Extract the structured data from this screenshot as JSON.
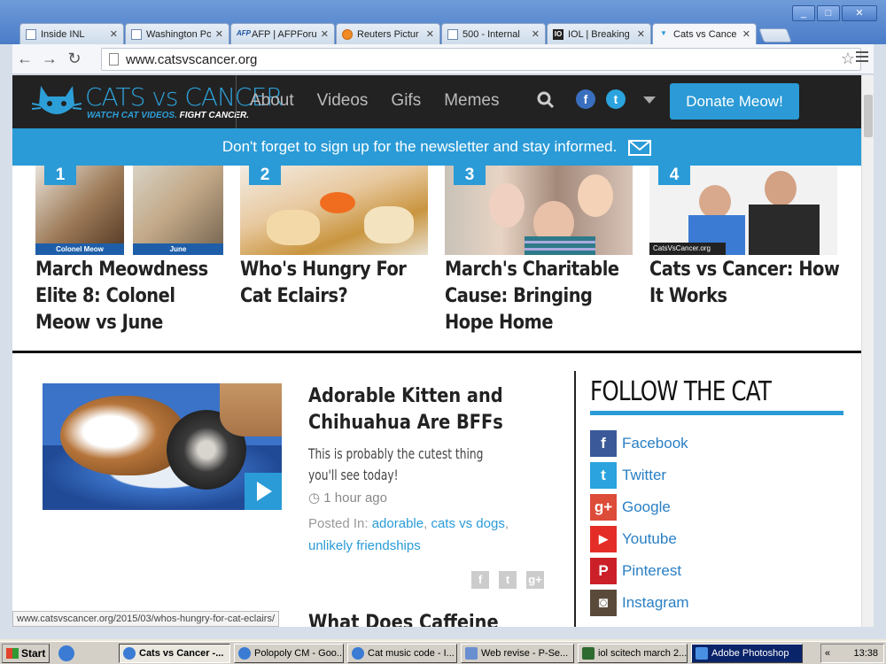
{
  "browser": {
    "tabs": [
      {
        "label": "Inside INL",
        "icon": "page-icon"
      },
      {
        "label": "Washington Po",
        "icon": "page-icon"
      },
      {
        "label": "AFP | AFPForu",
        "icon": "afp-icon"
      },
      {
        "label": "Reuters Pictur",
        "icon": "reuters-icon"
      },
      {
        "label": "500 - Internal",
        "icon": "page-icon"
      },
      {
        "label": "IOL | Breaking",
        "icon": "iol-icon"
      },
      {
        "label": "Cats vs Cance",
        "icon": "cats-icon",
        "active": true
      }
    ],
    "url": "www.catsvscancer.org",
    "status_url": "www.catsvscancer.org/2015/03/whos-hungry-for-cat-eclairs/"
  },
  "site": {
    "brand": "CATS vs CANCER",
    "tagline_blue": "WATCH CAT VIDEOS.",
    "tagline_white": "FIGHT CANCER.",
    "nav": [
      "About",
      "Videos",
      "Gifs",
      "Memes"
    ],
    "donate_label": "Donate Meow!",
    "newsletter": "Don't forget to sign up for the newsletter and stay informed.",
    "accent_color": "#2a9bd7"
  },
  "featured": [
    {
      "num": "1",
      "title": "March Meowdness Elite 8: Colonel Meow vs June",
      "captions": [
        "Colonel Meow",
        "June"
      ]
    },
    {
      "num": "2",
      "title": "Who's Hungry For Cat Eclairs?"
    },
    {
      "num": "3",
      "title": "March's Charitable Cause: Bringing Hope Home"
    },
    {
      "num": "4",
      "title": "Cats vs Cancer: How It Works",
      "caption": "CatsVsCancer.org"
    }
  ],
  "article": {
    "title": "Adorable Kitten and Chihuahua Are BFFs",
    "subtitle": "This is probably the cutest thing you'll see today!",
    "time": "1 hour ago",
    "posted_prefix": "Posted In:",
    "tags": [
      "adorable",
      "cats vs dogs",
      "unlikely friendships"
    ],
    "next_title": "What Does Caffeine Do"
  },
  "follow": {
    "heading": "FOLLOW THE CAT",
    "items": [
      {
        "label": "Facebook",
        "glyph": "f",
        "color": "#3b5998"
      },
      {
        "label": "Twitter",
        "glyph": "t",
        "color": "#2aa3de"
      },
      {
        "label": "Google",
        "glyph": "g+",
        "color": "#dd4b39"
      },
      {
        "label": "Youtube",
        "glyph": "▶",
        "color": "#e52d27"
      },
      {
        "label": "Pinterest",
        "glyph": "P",
        "color": "#cb2027"
      },
      {
        "label": "Instagram",
        "glyph": "◙",
        "color": "#5a4a3a"
      }
    ]
  },
  "taskbar": {
    "start": "Start",
    "tasks": [
      {
        "label": "Cats vs Cancer -...",
        "active": true
      },
      {
        "label": "Polopoly CM - Goo..."
      },
      {
        "label": "Cat music code - I..."
      },
      {
        "label": "Web revise - P-Se..."
      },
      {
        "label": "iol scitech march 2..."
      },
      {
        "label": "Adobe Photoshop",
        "ps": true
      }
    ],
    "clock": "13:38"
  }
}
